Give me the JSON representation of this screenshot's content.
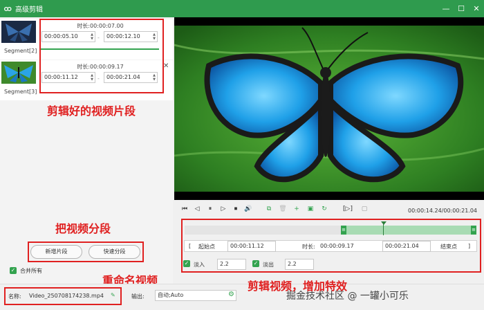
{
  "window": {
    "title": "高级剪辑",
    "minimize": "—",
    "maximize": "☐",
    "close": "✕"
  },
  "segments": [
    {
      "label": "Segment[2]",
      "duration_label": "时长:",
      "duration": "00:00:07.00",
      "start": "00:00:05.10",
      "end": "00:00:12.10",
      "dash": "-"
    },
    {
      "label": "Segment[3]",
      "duration_label": "时长:",
      "duration": "00:00:09.17",
      "start": "00:00:11.12",
      "end": "00:00:21.04",
      "dash": "-",
      "close": "✕"
    }
  ],
  "left_actions": {
    "new_segment": "新增片段",
    "quick_split": "快速分段",
    "merge_all": "合并所有"
  },
  "bottom": {
    "name_label": "名称:",
    "name_value": "Video_250708174238.mp4",
    "output_label": "输出:",
    "output_value": "自动;Auto",
    "footer_text": "掘金技术社区 @ 一罐小可乐"
  },
  "annotations": {
    "clipped_segments": "剪辑好的视频片段",
    "split_video": "把视频分段",
    "rename_video": "重命名视频",
    "clip_effects": "剪辑视频，增加特效"
  },
  "player": {
    "time_display": "00:00:14.24/00:00:21.04",
    "controls": [
      "⏮",
      "◁",
      "⏸",
      "▷",
      "⏹",
      "🔊",
      "⧉",
      "🗑",
      "+",
      "▣",
      "↻",
      "[▷]",
      "▢"
    ]
  },
  "clip": {
    "start_button": "起始点",
    "start_value": "00:00:11.12",
    "duration_label": "时长:",
    "duration_value": "00:00:09.17",
    "end_value": "00:00:21.04",
    "end_button": "结束点",
    "fade_in_label": "淡入",
    "fade_in_value": "2.2",
    "fade_out_label": "淡出",
    "fade_out_value": "2.2",
    "bracket_left": "[",
    "bracket_right": "]"
  },
  "colors": {
    "accent": "#2f9b4e",
    "annotation": "#e02020"
  }
}
